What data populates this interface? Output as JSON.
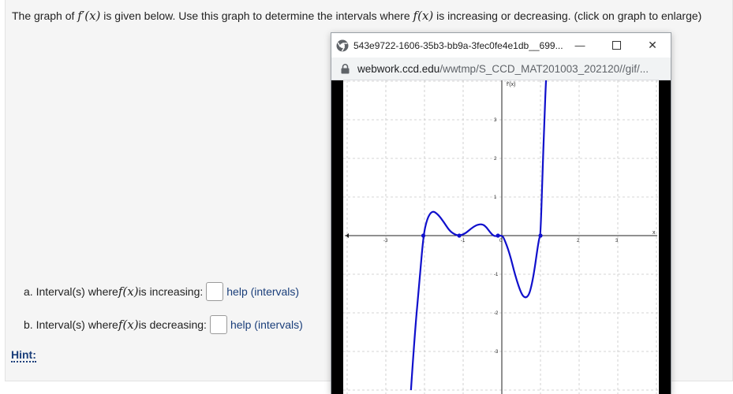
{
  "question": {
    "p1": "The graph of ",
    "fprime": "f",
    "prime_mark": "′",
    "x_paren": "(x)",
    "p2": " is given below. Use this graph to determine the intervals where ",
    "f": "f",
    "p3": " is increasing or decreasing. (click on graph to enlarge)"
  },
  "part_a": {
    "pre": "a. Interval(s) where ",
    "f": "f",
    "x_paren": "(x)",
    "post": " is increasing:",
    "value": "",
    "help": "help (intervals)"
  },
  "part_b": {
    "pre": "b. Interval(s) where ",
    "f": "f",
    "x_paren": "(x)",
    "post": " is decreasing:",
    "value": "",
    "help": "help (intervals)"
  },
  "hint": "Hint:",
  "popup": {
    "title": "543e9722-1606-35b3-bb9a-3fec0fe4e1db__699...",
    "minimize": "—",
    "close": "✕",
    "url_host": "webwork.ccd.edu",
    "url_path": "/wwtmp/S_CCD_MAT201003_202120//gif/..."
  },
  "chart_data": {
    "type": "line",
    "title": "",
    "ylabel": "f'(x)",
    "xlabel": "x",
    "xlim": [
      -4,
      4
    ],
    "ylim": [
      -4,
      4
    ],
    "grid": true,
    "x_ticks": [
      "-3",
      "-1",
      "0",
      "2",
      "3"
    ],
    "y_ticks": [
      "3",
      "2",
      "1",
      "-1",
      "-2",
      "-3"
    ],
    "series": [
      {
        "color": "#1010cc",
        "x": [
          -2.35,
          -2.25,
          -2.13,
          -2.03,
          -1.93,
          -1.8,
          -1.65,
          -1.5,
          -1.35,
          -1.2,
          -1.1,
          -0.95,
          -0.8,
          -0.65,
          -0.5,
          -0.4,
          -0.3,
          -0.2,
          -0.1,
          0.0,
          0.05,
          0.2,
          0.35,
          0.5,
          0.6,
          0.7,
          0.78,
          0.85,
          0.92,
          0.97,
          1.0,
          1.05,
          1.1,
          1.15,
          1.2
        ],
        "y": [
          -4.0,
          -2.5,
          -1.2,
          0.0,
          0.45,
          0.65,
          0.55,
          0.35,
          0.12,
          0.02,
          0.0,
          0.05,
          0.18,
          0.28,
          0.3,
          0.22,
          0.08,
          -0.02,
          0.0,
          0.0,
          -0.05,
          -0.45,
          -1.05,
          -1.5,
          -1.62,
          -1.55,
          -1.25,
          -0.85,
          -0.35,
          -0.05,
          0.0,
          1.5,
          3.0,
          4.2,
          5.0
        ]
      }
    ],
    "points": [
      {
        "x": -2.03,
        "y": 0
      },
      {
        "x": -1.1,
        "y": 0
      },
      {
        "x": -0.1,
        "y": 0
      },
      {
        "x": 1.0,
        "y": 0
      }
    ]
  }
}
